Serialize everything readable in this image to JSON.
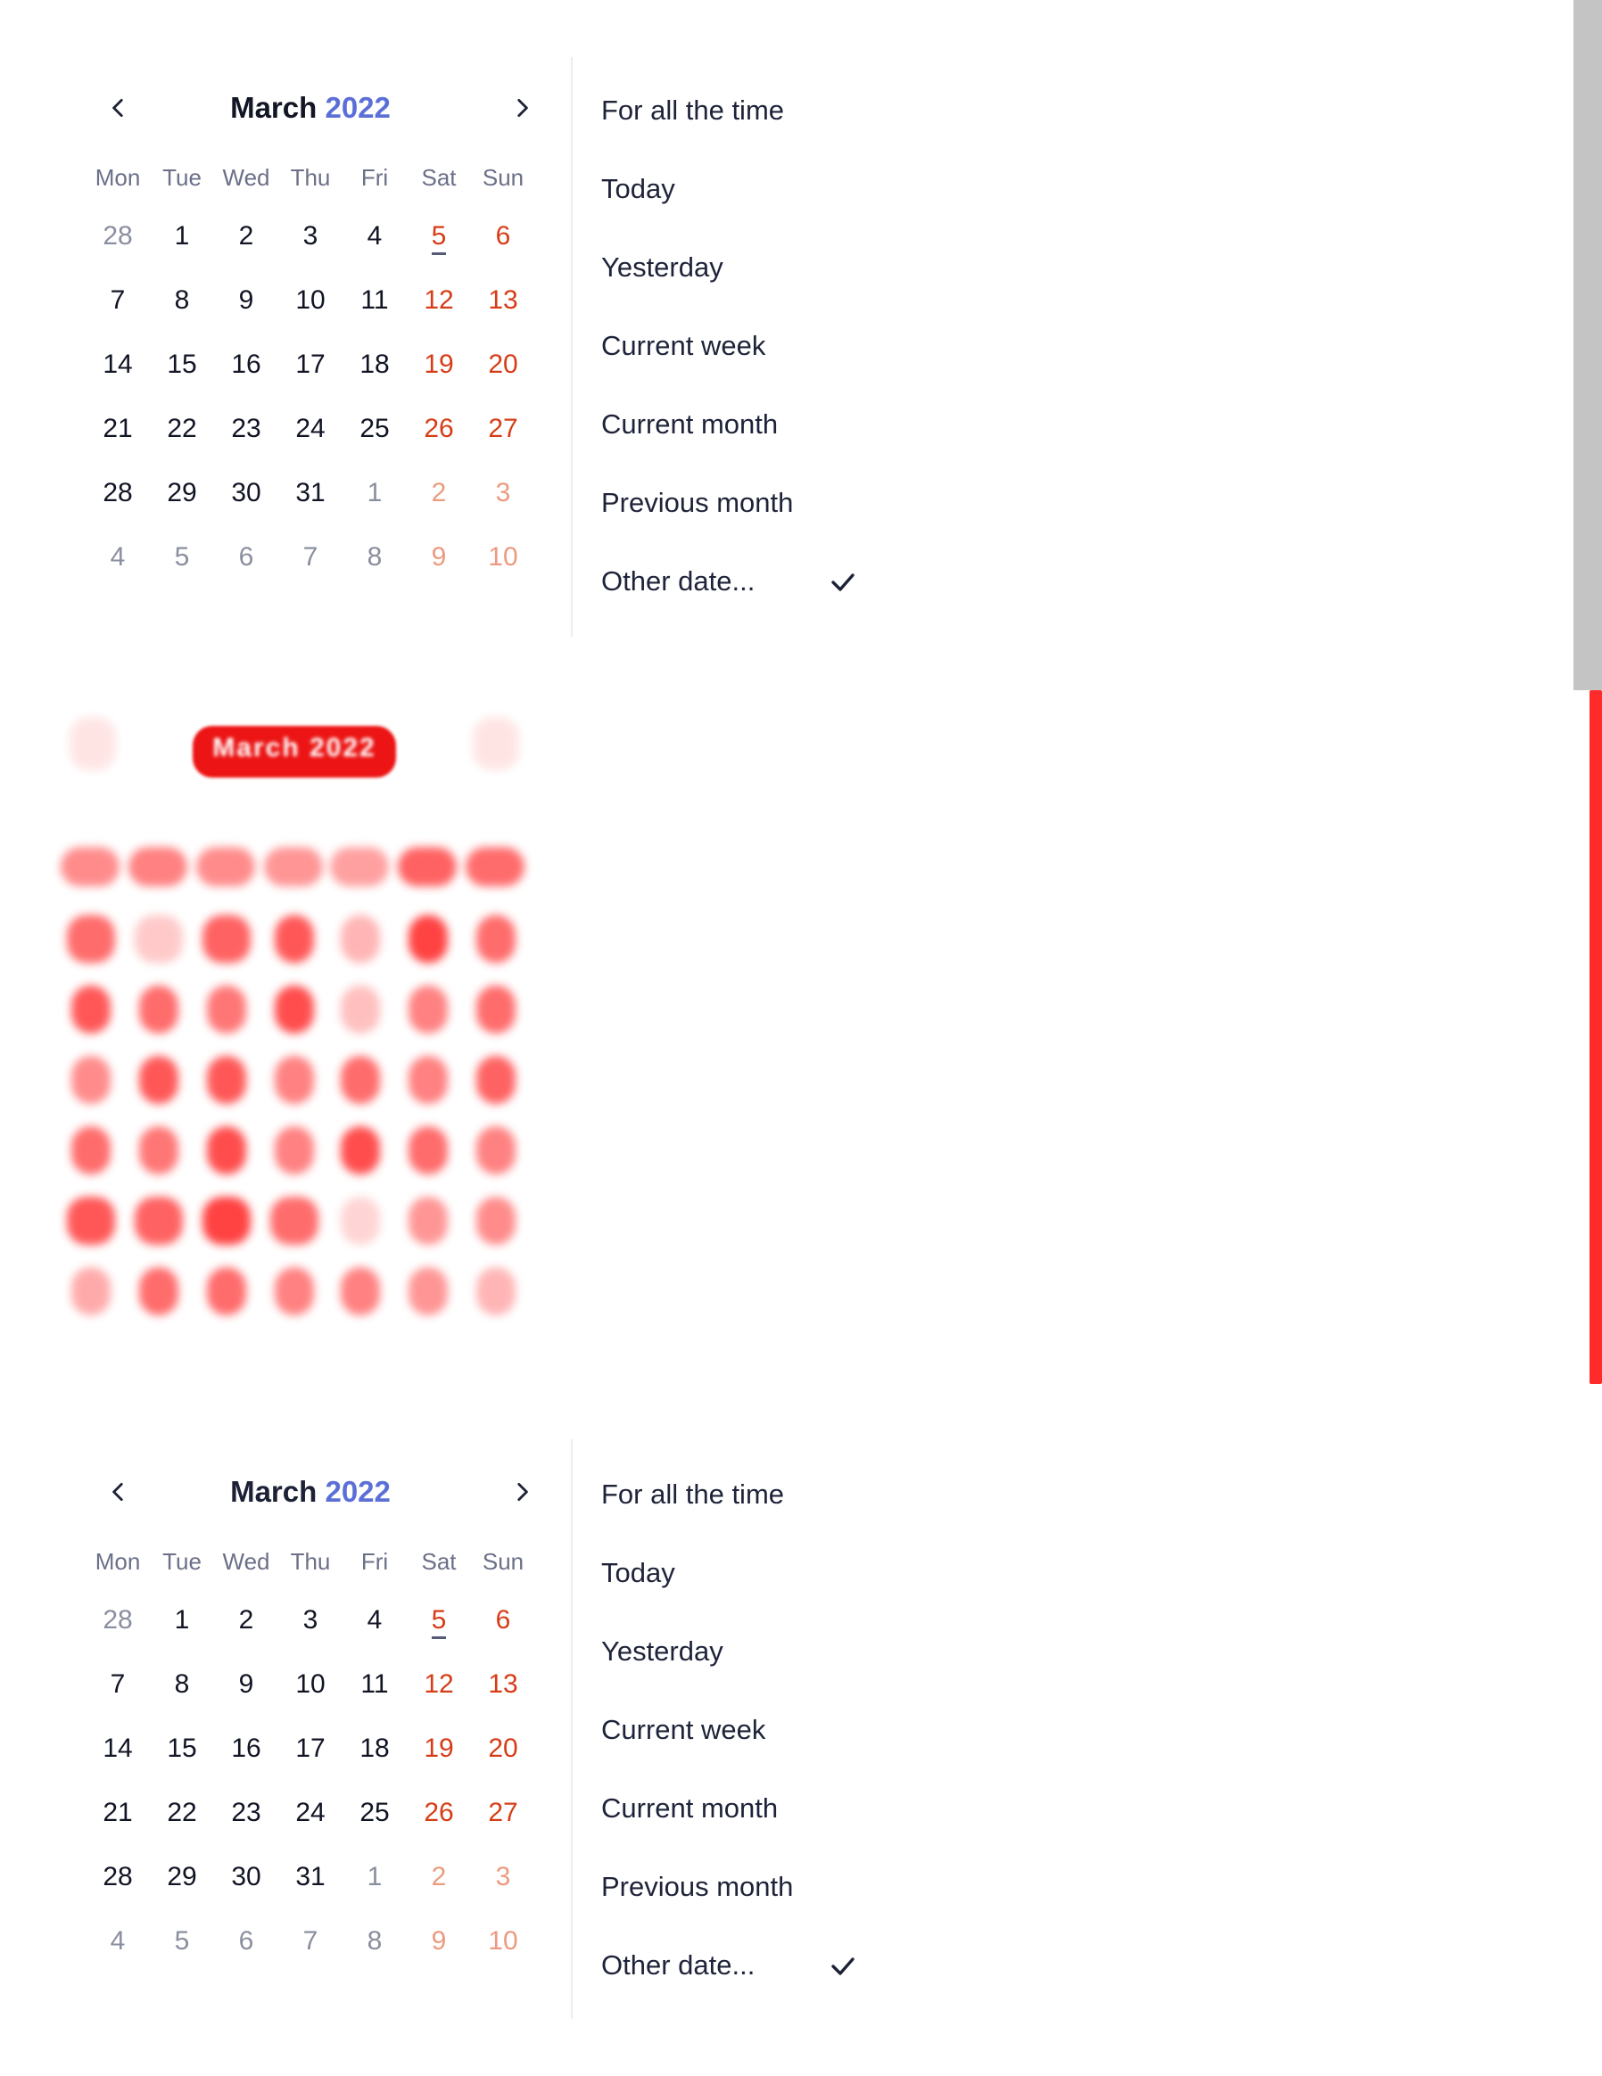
{
  "calendar": {
    "month": "March",
    "year": "2022",
    "weekdays": [
      "Mon",
      "Tue",
      "Wed",
      "Thu",
      "Fri",
      "Sat",
      "Sun"
    ],
    "days": [
      "28",
      "1",
      "2",
      "3",
      "4",
      "5",
      "6",
      "7",
      "8",
      "9",
      "10",
      "11",
      "12",
      "13",
      "14",
      "15",
      "16",
      "17",
      "18",
      "19",
      "20",
      "21",
      "22",
      "23",
      "24",
      "25",
      "26",
      "27",
      "28",
      "29",
      "30",
      "31",
      "1",
      "2",
      "3",
      "4",
      "5",
      "6",
      "7",
      "8",
      "9",
      "10"
    ],
    "today": "5",
    "prev_icon": "chevron-left-icon",
    "next_icon": "chevron-right-icon"
  },
  "menu": {
    "items": [
      "For all the time",
      "Today",
      "Yesterday",
      "Current week",
      "Current month",
      "Previous month",
      "Other date..."
    ],
    "selected_index": 6,
    "selected_icon": "check-icon"
  },
  "ghost": {
    "title": "March 2022"
  },
  "colors": {
    "year_accent": "#5b6fd6",
    "weekend": "#d63d17",
    "weekend_muted": "#ec9a80",
    "muted": "#8a8f9f",
    "highlight": "#ff2e2e"
  }
}
